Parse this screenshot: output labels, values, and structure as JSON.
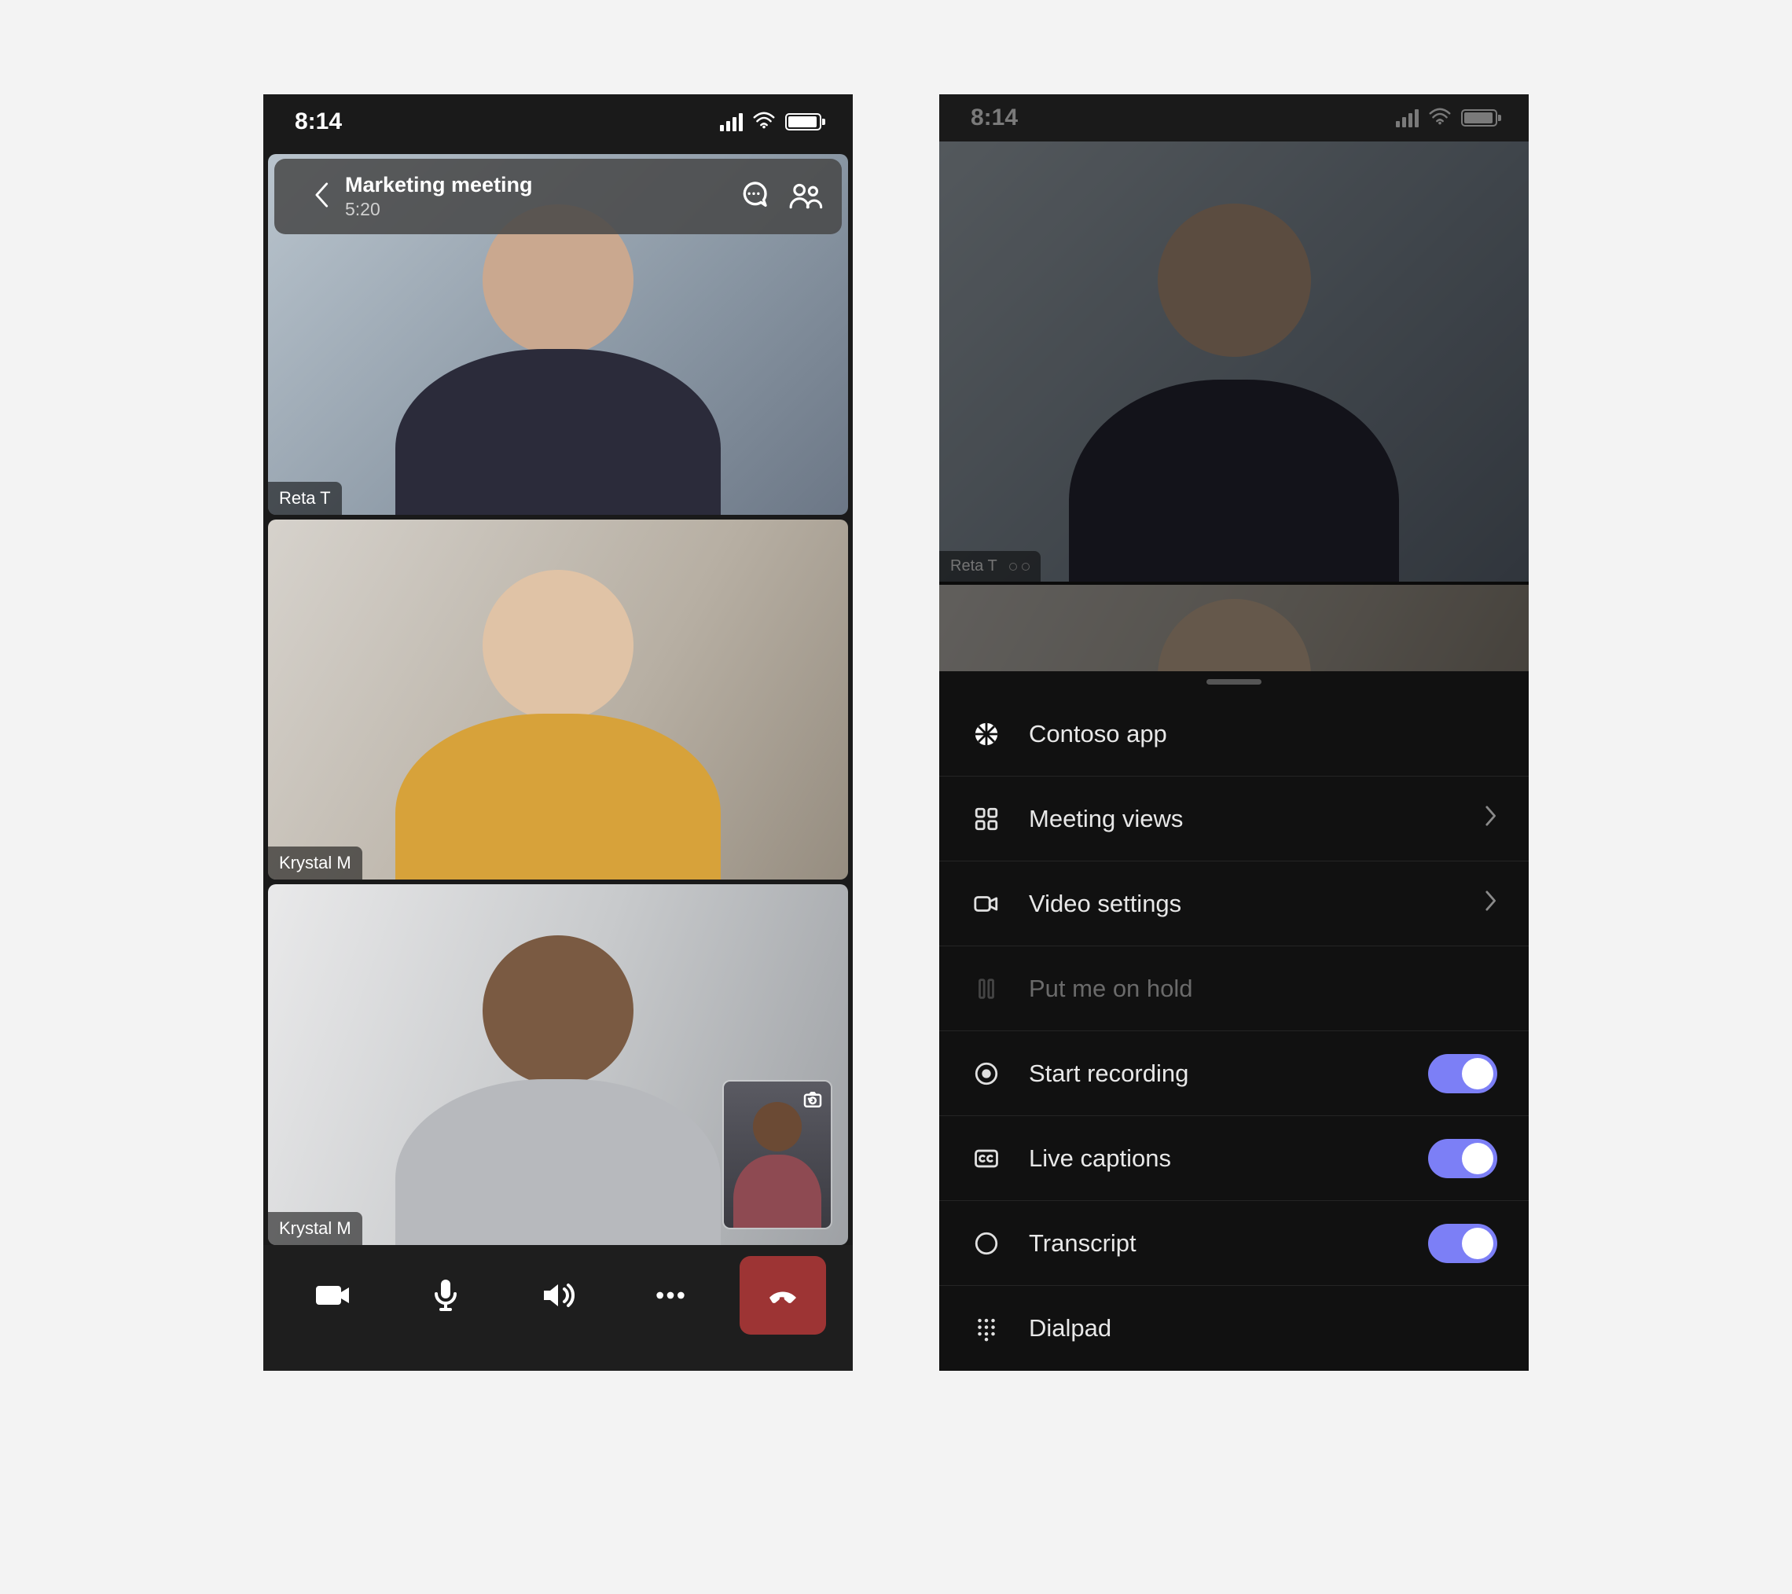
{
  "status": {
    "time": "8:14"
  },
  "phone1": {
    "header": {
      "title": "Marketing meeting",
      "duration": "5:20"
    },
    "participants": [
      {
        "name": "Reta T"
      },
      {
        "name": "Krystal M"
      },
      {
        "name": "Krystal M"
      }
    ]
  },
  "phone2": {
    "participant_label": "Reta T",
    "menu": {
      "items": [
        {
          "id": "contoso",
          "label": "Contoso app",
          "icon": "app-icon",
          "type": "nav",
          "enabled": true
        },
        {
          "id": "views",
          "label": "Meeting views",
          "icon": "grid-icon",
          "type": "disclose",
          "enabled": true
        },
        {
          "id": "video-settings",
          "label": "Video settings",
          "icon": "video-icon",
          "type": "disclose",
          "enabled": true
        },
        {
          "id": "hold",
          "label": "Put me on hold",
          "icon": "hold-icon",
          "type": "nav",
          "enabled": false
        },
        {
          "id": "recording",
          "label": "Start recording",
          "icon": "record-icon",
          "type": "toggle",
          "enabled": true,
          "on": true
        },
        {
          "id": "captions",
          "label": "Live captions",
          "icon": "cc-icon",
          "type": "toggle",
          "enabled": true,
          "on": true
        },
        {
          "id": "transcript",
          "label": "Transcript",
          "icon": "circle-icon",
          "type": "toggle",
          "enabled": true,
          "on": true
        },
        {
          "id": "dialpad",
          "label": "Dialpad",
          "icon": "dialpad-icon",
          "type": "nav",
          "enabled": true
        }
      ]
    }
  },
  "colors": {
    "toggle_on": "#7c7ff6",
    "hangup": "#9d3434"
  }
}
